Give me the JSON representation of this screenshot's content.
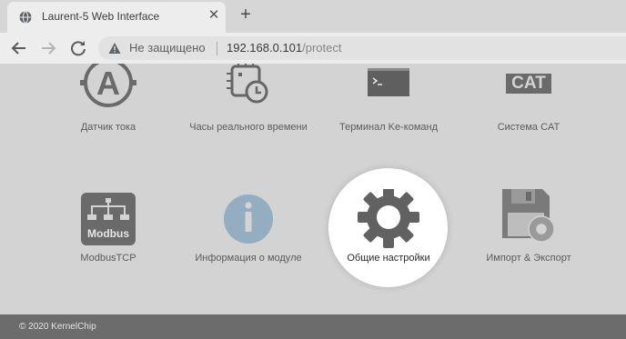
{
  "browser": {
    "tab_title": "Laurent-5 Web Interface",
    "security_label": "Не защищено",
    "url_host": "192.168.0.101",
    "url_path": "/protect"
  },
  "tiles": [
    {
      "label": "Датчик тока",
      "icon": "current-sensor-icon"
    },
    {
      "label": "Часы реального времени",
      "icon": "rtc-clock-icon"
    },
    {
      "label": "Терминал Ke-команд",
      "icon": "terminal-icon"
    },
    {
      "label": "Система CAT",
      "icon": "cat-system-icon",
      "icon_text": "CAT"
    },
    {
      "label": "ModbusTCP",
      "icon": "modbus-icon",
      "icon_text": "Modbus"
    },
    {
      "label": "Информация о модуле",
      "icon": "info-icon"
    },
    {
      "label": "Общие настройки",
      "icon": "gear-icon",
      "highlighted": true
    },
    {
      "label": "Импорт & Экспорт",
      "icon": "floppy-gear-icon"
    }
  ],
  "footer": {
    "text": "© 2020 KernelChip"
  },
  "colors": {
    "icon_gray": "#6a6a6a",
    "info_blue": "#93aec0",
    "footer_bg": "#6c6c6c",
    "page_bg": "#d3d3d3"
  }
}
